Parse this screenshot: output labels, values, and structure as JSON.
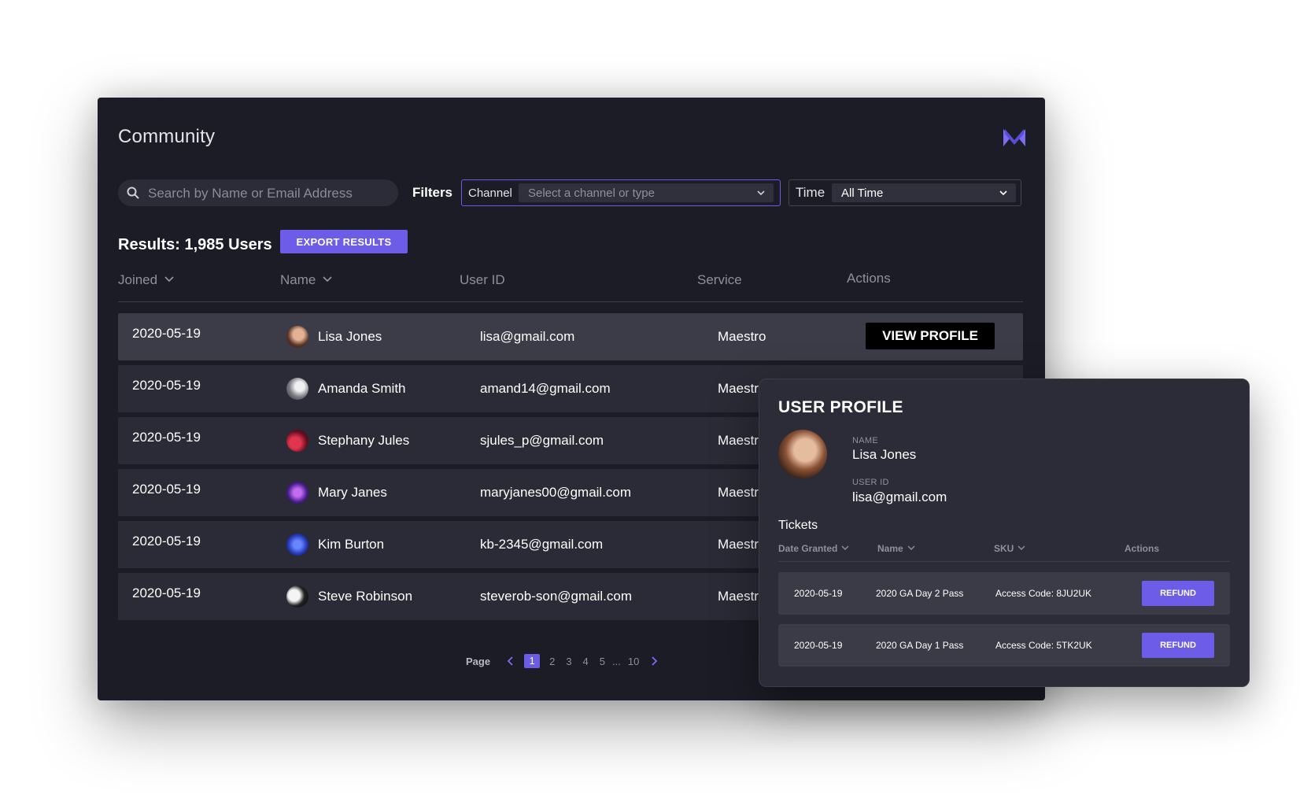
{
  "app": {
    "title": "Community",
    "logo_icon": "m-logo-icon",
    "accent": "#6c5ce7"
  },
  "search": {
    "placeholder": "Search by Name or Email Address",
    "value": ""
  },
  "filters": {
    "label": "Filters",
    "channel": {
      "label": "Channel",
      "placeholder": "Select a channel or type"
    },
    "time": {
      "label": "Time",
      "value": "All Time"
    }
  },
  "results": {
    "label": "Results: 1,985 Users",
    "export_label": "EXPORT RESULTS"
  },
  "table": {
    "columns": [
      "Joined",
      "Name",
      "User ID",
      "Service",
      "Actions"
    ],
    "rows": [
      {
        "joined": "2020-05-19",
        "name": "Lisa Jones",
        "user_id": "lisa@gmail.com",
        "service": "Maestro",
        "action": "VIEW PROFILE",
        "avatar_color": "#c98a6a"
      },
      {
        "joined": "2020-05-19",
        "name": "Amanda Smith",
        "user_id": "amand14@gmail.com",
        "service": "Maestro",
        "avatar_color": "#9c9ca4"
      },
      {
        "joined": "2020-05-19",
        "name": "Stephany Jules",
        "user_id": "sjules_p@gmail.com",
        "service": "Maestro",
        "avatar_color": "#c2304a"
      },
      {
        "joined": "2020-05-19",
        "name": "Mary Janes",
        "user_id": "maryjanes00@gmail.com",
        "service": "Maestro",
        "avatar_color": "#7a3fd0"
      },
      {
        "joined": "2020-05-19",
        "name": "Kim Burton",
        "user_id": "kb-2345@gmail.com",
        "service": "Maestro",
        "avatar_color": "#2f49c9"
      },
      {
        "joined": "2020-05-19",
        "name": "Steve Robinson",
        "user_id": "steverob-son@gmail.com",
        "service": "Maestro",
        "avatar_color": "#1b1b1b"
      }
    ]
  },
  "pagination": {
    "label": "Page",
    "pages": [
      "1",
      "2",
      "3",
      "4",
      "5",
      "...",
      "10"
    ],
    "current": "1"
  },
  "profile": {
    "title": "USER PROFILE",
    "name_label": "NAME",
    "name": "Lisa Jones",
    "user_id_label": "USER ID",
    "user_id": "lisa@gmail.com",
    "tickets_label": "Tickets",
    "ticket_columns": [
      "Date Granted",
      "Name",
      "SKU",
      "Actions"
    ],
    "tickets": [
      {
        "date": "2020-05-19",
        "name": "2020 GA Day 2 Pass",
        "sku": "Access Code: 8JU2UK",
        "action": "REFUND"
      },
      {
        "date": "2020-05-19",
        "name": "2020 GA Day 1 Pass",
        "sku": "Access Code: 5TK2UK",
        "action": "REFUND"
      }
    ]
  }
}
